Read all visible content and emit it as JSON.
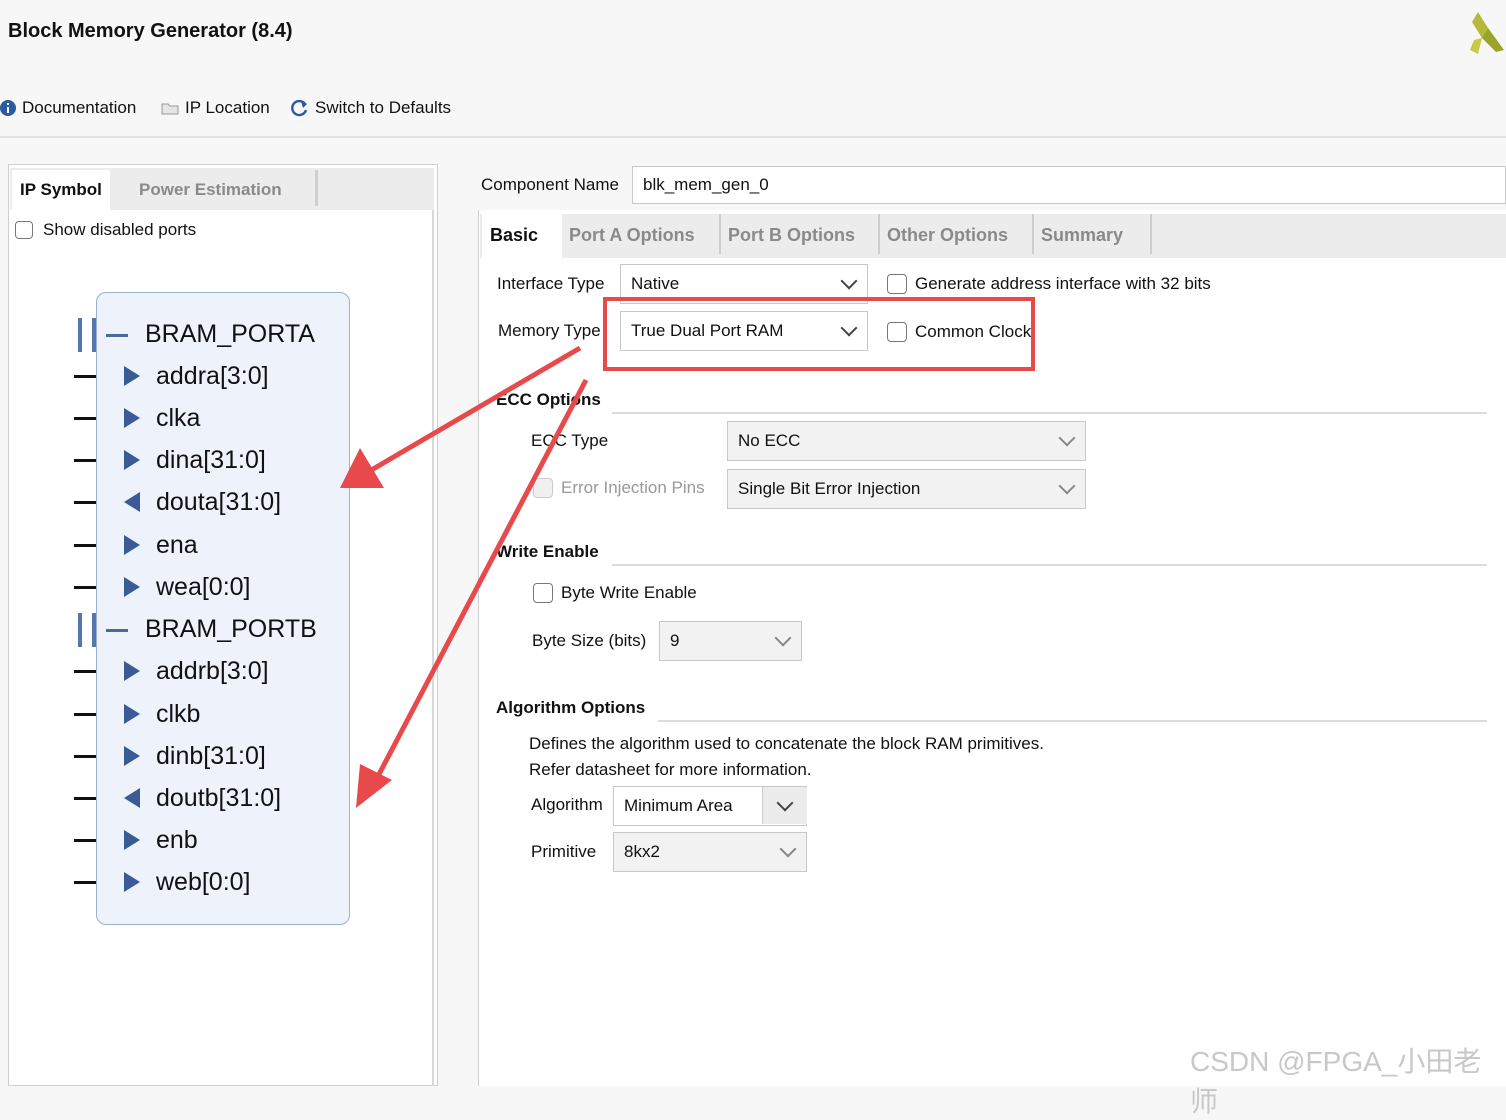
{
  "window": {
    "title": "Block Memory Generator (8.4)"
  },
  "toolbar": {
    "documentation": "Documentation",
    "ip_location": "IP Location",
    "switch_defaults": "Switch to Defaults"
  },
  "left_tabs": [
    "IP Symbol",
    "Power Estimation"
  ],
  "show_disabled_ports": {
    "label": "Show disabled ports",
    "checked": false
  },
  "symbol": {
    "porta": {
      "name": "BRAM_PORTA",
      "pins": [
        {
          "name": "addra[3:0]",
          "dir": "in"
        },
        {
          "name": "clka",
          "dir": "in"
        },
        {
          "name": "dina[31:0]",
          "dir": "in"
        },
        {
          "name": "douta[31:0]",
          "dir": "out"
        },
        {
          "name": "ena",
          "dir": "in"
        },
        {
          "name": "wea[0:0]",
          "dir": "in"
        }
      ]
    },
    "portb": {
      "name": "BRAM_PORTB",
      "pins": [
        {
          "name": "addrb[3:0]",
          "dir": "in"
        },
        {
          "name": "clkb",
          "dir": "in"
        },
        {
          "name": "dinb[31:0]",
          "dir": "in"
        },
        {
          "name": "doutb[31:0]",
          "dir": "out"
        },
        {
          "name": "enb",
          "dir": "in"
        },
        {
          "name": "web[0:0]",
          "dir": "in"
        }
      ]
    }
  },
  "component": {
    "label": "Component Name",
    "value": "blk_mem_gen_0"
  },
  "right_tabs": [
    "Basic",
    "Port A Options",
    "Port B Options",
    "Other Options",
    "Summary"
  ],
  "basic": {
    "interface_type": {
      "label": "Interface Type",
      "value": "Native"
    },
    "gen_addr_32": {
      "label": "Generate address interface with 32 bits",
      "checked": false
    },
    "memory_type": {
      "label": "Memory Type",
      "value": "True Dual Port RAM"
    },
    "common_clock": {
      "label": "Common Clock",
      "checked": false
    }
  },
  "ecc": {
    "title": "ECC Options",
    "type_label": "ECC Type",
    "type_value": "No ECC",
    "injection_label": "Error Injection Pins",
    "injection_value": "Single Bit Error Injection"
  },
  "write_enable": {
    "title": "Write Enable",
    "byte_write_label": "Byte Write Enable",
    "byte_size_label": "Byte Size (bits)",
    "byte_size_value": "9"
  },
  "algorithm": {
    "title": "Algorithm Options",
    "desc1": "Defines the algorithm used to concatenate the block RAM primitives.",
    "desc2": "Refer datasheet for more information.",
    "algorithm_label": "Algorithm",
    "algorithm_value": "Minimum Area",
    "primitive_label": "Primitive",
    "primitive_value": "8kx2"
  },
  "watermark": "CSDN @FPGA_小田老师",
  "colors": {
    "annotation_red": "#e8494a",
    "symbol_blue": "#3a5b95"
  }
}
